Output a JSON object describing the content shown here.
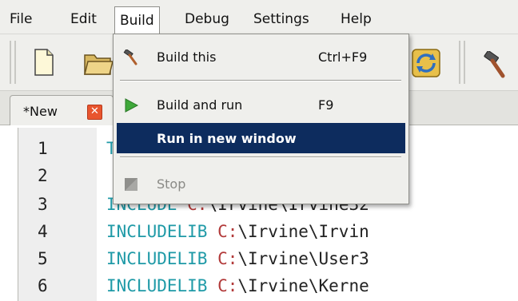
{
  "menubar": {
    "items": [
      {
        "label": "File"
      },
      {
        "label": "Edit"
      },
      {
        "label": "Build"
      },
      {
        "label": "Debug"
      },
      {
        "label": "Settings"
      },
      {
        "label": "Help"
      }
    ]
  },
  "toolbar": {
    "icons": [
      "new-file-icon",
      "open-folder-icon",
      "refresh-icon",
      "build-hammer-icon"
    ]
  },
  "tabs": [
    {
      "label": "*New",
      "close_icon": "close-icon"
    }
  ],
  "build_menu": {
    "items": [
      {
        "label": "Build this",
        "shortcut": "Ctrl+F9",
        "icon": "hammer-icon"
      },
      {
        "label": "Build and run",
        "shortcut": "F9",
        "icon": "play-icon"
      },
      {
        "label": "Run in new window",
        "shortcut": "",
        "icon": ""
      },
      {
        "label": "Stop",
        "shortcut": "",
        "icon": "stop-icon",
        "disabled": true
      }
    ]
  },
  "editor": {
    "line_numbers": [
      "1",
      "2",
      "3",
      "4",
      "5",
      "6"
    ],
    "lines": [
      {
        "kw": "T",
        "drive": "",
        "path": ""
      },
      {
        "kw": "",
        "drive": "",
        "path": ""
      },
      {
        "kw": "INCLUDE ",
        "drive": "C:",
        "path": "\\Irvine\\Irvine32"
      },
      {
        "kw": "INCLUDELIB ",
        "drive": "C:",
        "path": "\\Irvine\\Irvin"
      },
      {
        "kw": "INCLUDELIB ",
        "drive": "C:",
        "path": "\\Irvine\\User3"
      },
      {
        "kw": "INCLUDELIB ",
        "drive": "C:",
        "path": "\\Irvine\\Kerne"
      }
    ]
  },
  "colors": {
    "keyword": "#1f9aa7",
    "drive": "#b23a3a",
    "highlight": "#0d2c5e",
    "close_button": "#e8552e"
  }
}
